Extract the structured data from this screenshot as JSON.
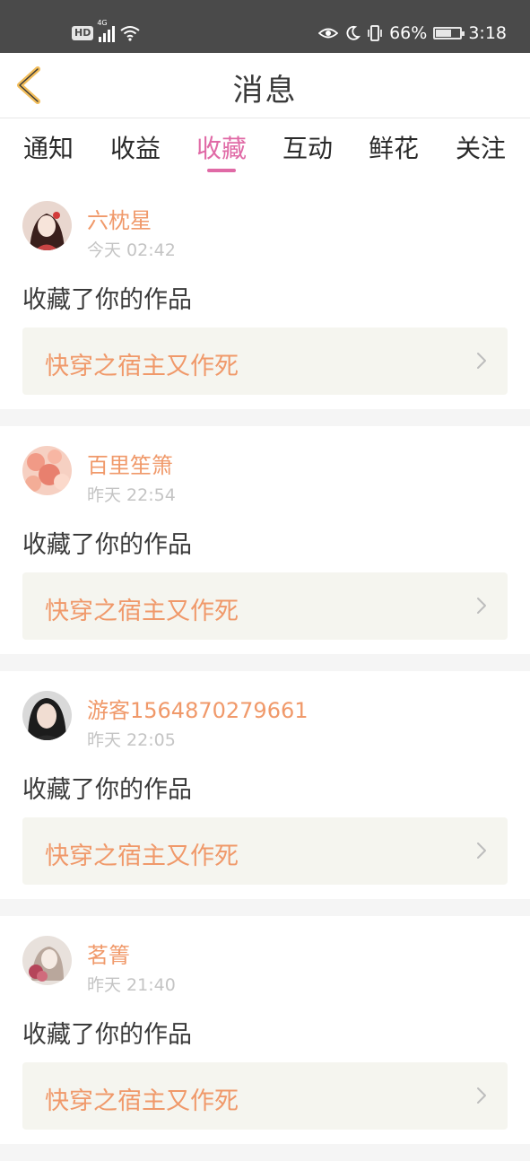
{
  "status_bar": {
    "hd_label": "HD",
    "network_label": "4G",
    "battery_percent": "66%",
    "battery_level": 0.66,
    "time": "3:18"
  },
  "header": {
    "title": "消息"
  },
  "tabs": [
    {
      "label": "通知",
      "active": false
    },
    {
      "label": "收益",
      "active": false
    },
    {
      "label": "收藏",
      "active": true
    },
    {
      "label": "互动",
      "active": false
    },
    {
      "label": "鲜花",
      "active": false
    },
    {
      "label": "关注",
      "active": false
    }
  ],
  "accent_colors": {
    "active_tab": "#e06aa6",
    "username": "#f0996a",
    "work_title": "#f0996a"
  },
  "notifications": [
    {
      "username": "六枕星",
      "time": "今天 02:42",
      "action": "收藏了你的作品",
      "work_title": "快穿之宿主又作死"
    },
    {
      "username": "百里笙箫",
      "time": "昨天 22:54",
      "action": "收藏了你的作品",
      "work_title": "快穿之宿主又作死"
    },
    {
      "username": "游客1564870279661",
      "time": "昨天 22:05",
      "action": "收藏了你的作品",
      "work_title": "快穿之宿主又作死"
    },
    {
      "username": "茗箐",
      "time": "昨天 21:40",
      "action": "收藏了你的作品",
      "work_title": "快穿之宿主又作死"
    }
  ]
}
